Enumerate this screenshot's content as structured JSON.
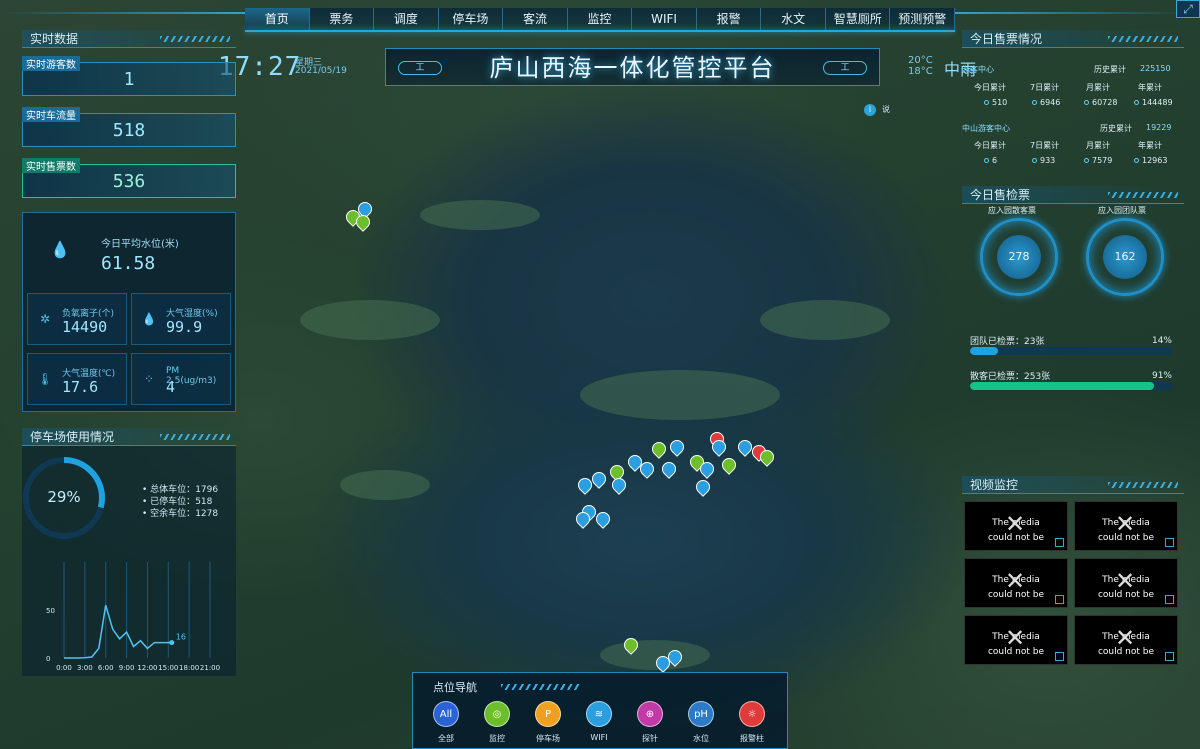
{
  "nav": {
    "items": [
      "首页",
      "票务",
      "调度",
      "停车场",
      "客流",
      "监控",
      "WIFI",
      "报警",
      "水文",
      "智慧厕所",
      "预测预警"
    ],
    "active_index": 0
  },
  "header": {
    "title": "庐山西海一体化管控平台",
    "tag_left": "工",
    "tag_right": "工",
    "time": "17:27",
    "weekday": "星期三",
    "date": "2021/05/19",
    "temp_high": "20°C",
    "temp_low": "18°C",
    "weather": "中雨",
    "corner_icon": "expand-icon"
  },
  "realtime": {
    "section_title": "实时数据",
    "visitors_label": "实时游客数",
    "visitors_value": "1",
    "traffic_label": "实时车流量",
    "traffic_value": "518",
    "tickets_label": "实时售票数",
    "tickets_value": "536"
  },
  "water": {
    "level_label": "今日平均水位(米)",
    "level_value": "61.58",
    "anion_label": "负氧离子(个)",
    "anion_value": "14490",
    "humidity_label": "大气湿度(%)",
    "humidity_value": "99.9",
    "temp_label": "大气温度(℃)",
    "temp_value": "17.6",
    "pm_label": "PM 2.5(ug/m3)",
    "pm_value": "4"
  },
  "parking": {
    "section_title": "停车场使用情况",
    "usage_pct_text": "29%",
    "usage_fraction": 0.29,
    "total_label": "总体车位：",
    "total_value": "1796",
    "used_label": "已停车位：",
    "used_value": "518",
    "free_label": "空余车位：",
    "free_value": "1278"
  },
  "chart_data": {
    "type": "line",
    "x": [
      "0:00",
      "3:00",
      "6:00",
      "9:00",
      "12:00",
      "15:00",
      "18:00",
      "21:00"
    ],
    "xlabel": "",
    "ylabel": "",
    "ylim": [
      0,
      100
    ],
    "yticks": [
      "0",
      "50"
    ],
    "series": [
      {
        "values": [
          0,
          0,
          0,
          0.2,
          1,
          10,
          55,
          30,
          20,
          27,
          12,
          18,
          10,
          16,
          16
        ]
      }
    ],
    "series_x_hours": [
      0,
      1,
      2,
      3,
      4,
      5,
      6,
      7,
      8,
      9,
      10,
      11,
      12,
      13,
      15.5
    ],
    "last_label": "16",
    "grid": false
  },
  "tickets": {
    "section_title": "今日售票情况",
    "center1_name": "游客中心",
    "center1_history_label": "历史累计",
    "center1_history": "225150",
    "center2_name": "中山游客中心",
    "center2_history_label": "历史累计",
    "center2_history": "19229",
    "col_labels": [
      "今日累计",
      "7日累计",
      "月累计",
      "年累计"
    ],
    "center1_values": [
      "510",
      "6946",
      "60728",
      "144489"
    ],
    "center2_values": [
      "6",
      "933",
      "7579",
      "12963"
    ]
  },
  "checks": {
    "section_title": "今日售检票",
    "gauge1_label": "应入园散客票",
    "gauge1_value": "278",
    "gauge2_label": "应入园团队票",
    "gauge2_value": "162",
    "team_label": "团队已检票：23张",
    "team_pct_text": "14%",
    "team_fraction": 0.14,
    "team_color": "#1ea3e0",
    "indiv_label": "散客已检票：253张",
    "indiv_pct_text": "91%",
    "indiv_fraction": 0.91,
    "indiv_color": "#13c48a"
  },
  "video": {
    "section_title": "视频监控",
    "tile_line1": "The media",
    "tile_line2": "could not be"
  },
  "map": {
    "info_text": "说",
    "accent": "#2aa5d8"
  },
  "bottom_nav": {
    "title": "点位导航",
    "items": [
      {
        "label": "全部",
        "icon_text": "All",
        "color": "#2a63d6",
        "icon": "all-icon"
      },
      {
        "label": "监控",
        "icon_text": "◎",
        "color": "#6cbf2a",
        "icon": "camera-icon"
      },
      {
        "label": "停车场",
        "icon_text": "P",
        "color": "#f0a020",
        "icon": "parking-icon"
      },
      {
        "label": "WIFI",
        "icon_text": "≋",
        "color": "#2a9ee0",
        "icon": "wifi-icon"
      },
      {
        "label": "探针",
        "icon_text": "⊕",
        "color": "#c03aa8",
        "icon": "probe-icon"
      },
      {
        "label": "水位",
        "icon_text": "pH",
        "color": "#2a7ac8",
        "icon": "water-level-icon"
      },
      {
        "label": "报警柱",
        "icon_text": "☼",
        "color": "#e03a3a",
        "icon": "alarm-icon"
      }
    ]
  }
}
